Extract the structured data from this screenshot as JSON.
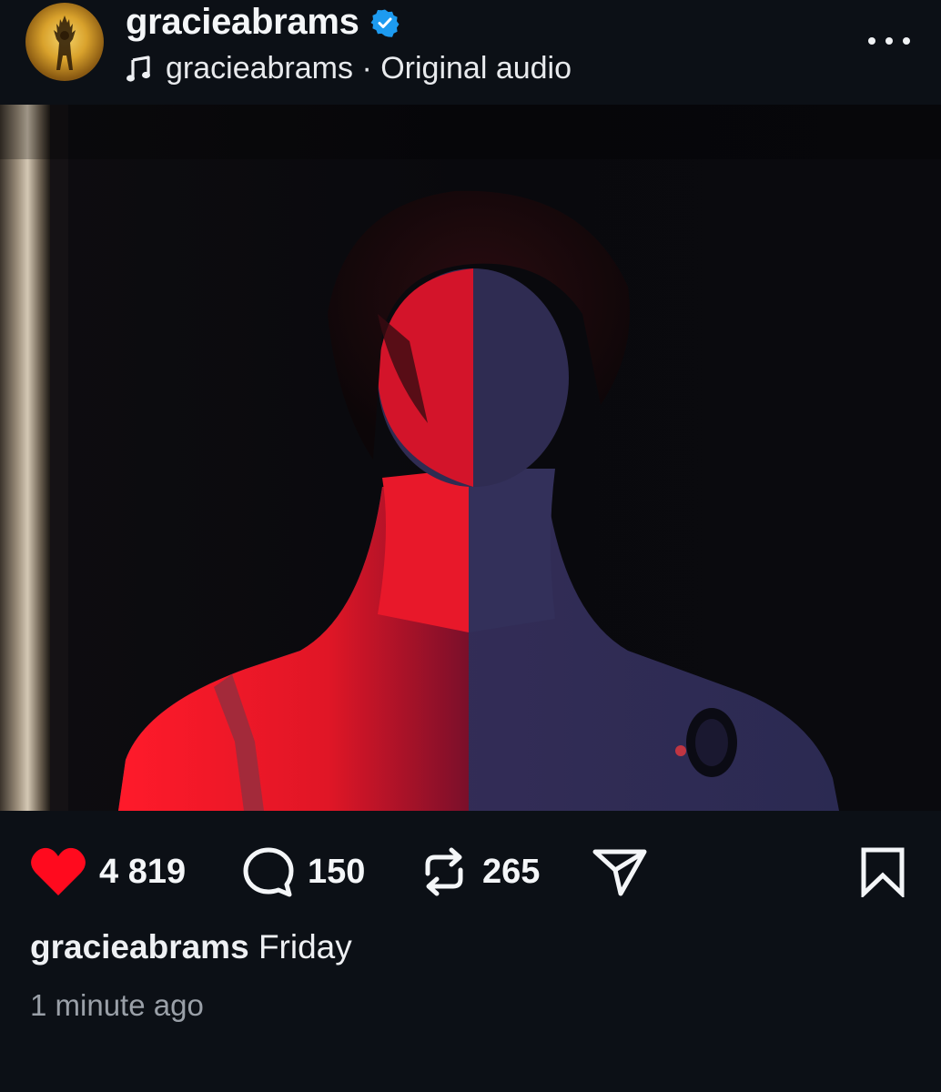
{
  "post": {
    "username": "gracieabrams",
    "verified": true,
    "audio_artist": "gracieabrams",
    "audio_separator": "·",
    "audio_title": "Original audio",
    "more_icon": "more-horizontal-icon"
  },
  "media": {
    "type": "video",
    "sound_icon": "speaker-on-icon"
  },
  "actions": {
    "likes": "4 819",
    "liked": true,
    "comments": "150",
    "reposts": "265",
    "icons": [
      "heart-icon",
      "comment-icon",
      "repost-icon",
      "share-icon",
      "bookmark-icon"
    ]
  },
  "caption": {
    "username": "gracieabrams",
    "text": "Friday"
  },
  "timestamp": "1 minute ago",
  "colors": {
    "background": "#0c1016",
    "like": "#ff0a1e",
    "verified": "#1d9bf0",
    "muted_text": "#9aa0a8"
  }
}
